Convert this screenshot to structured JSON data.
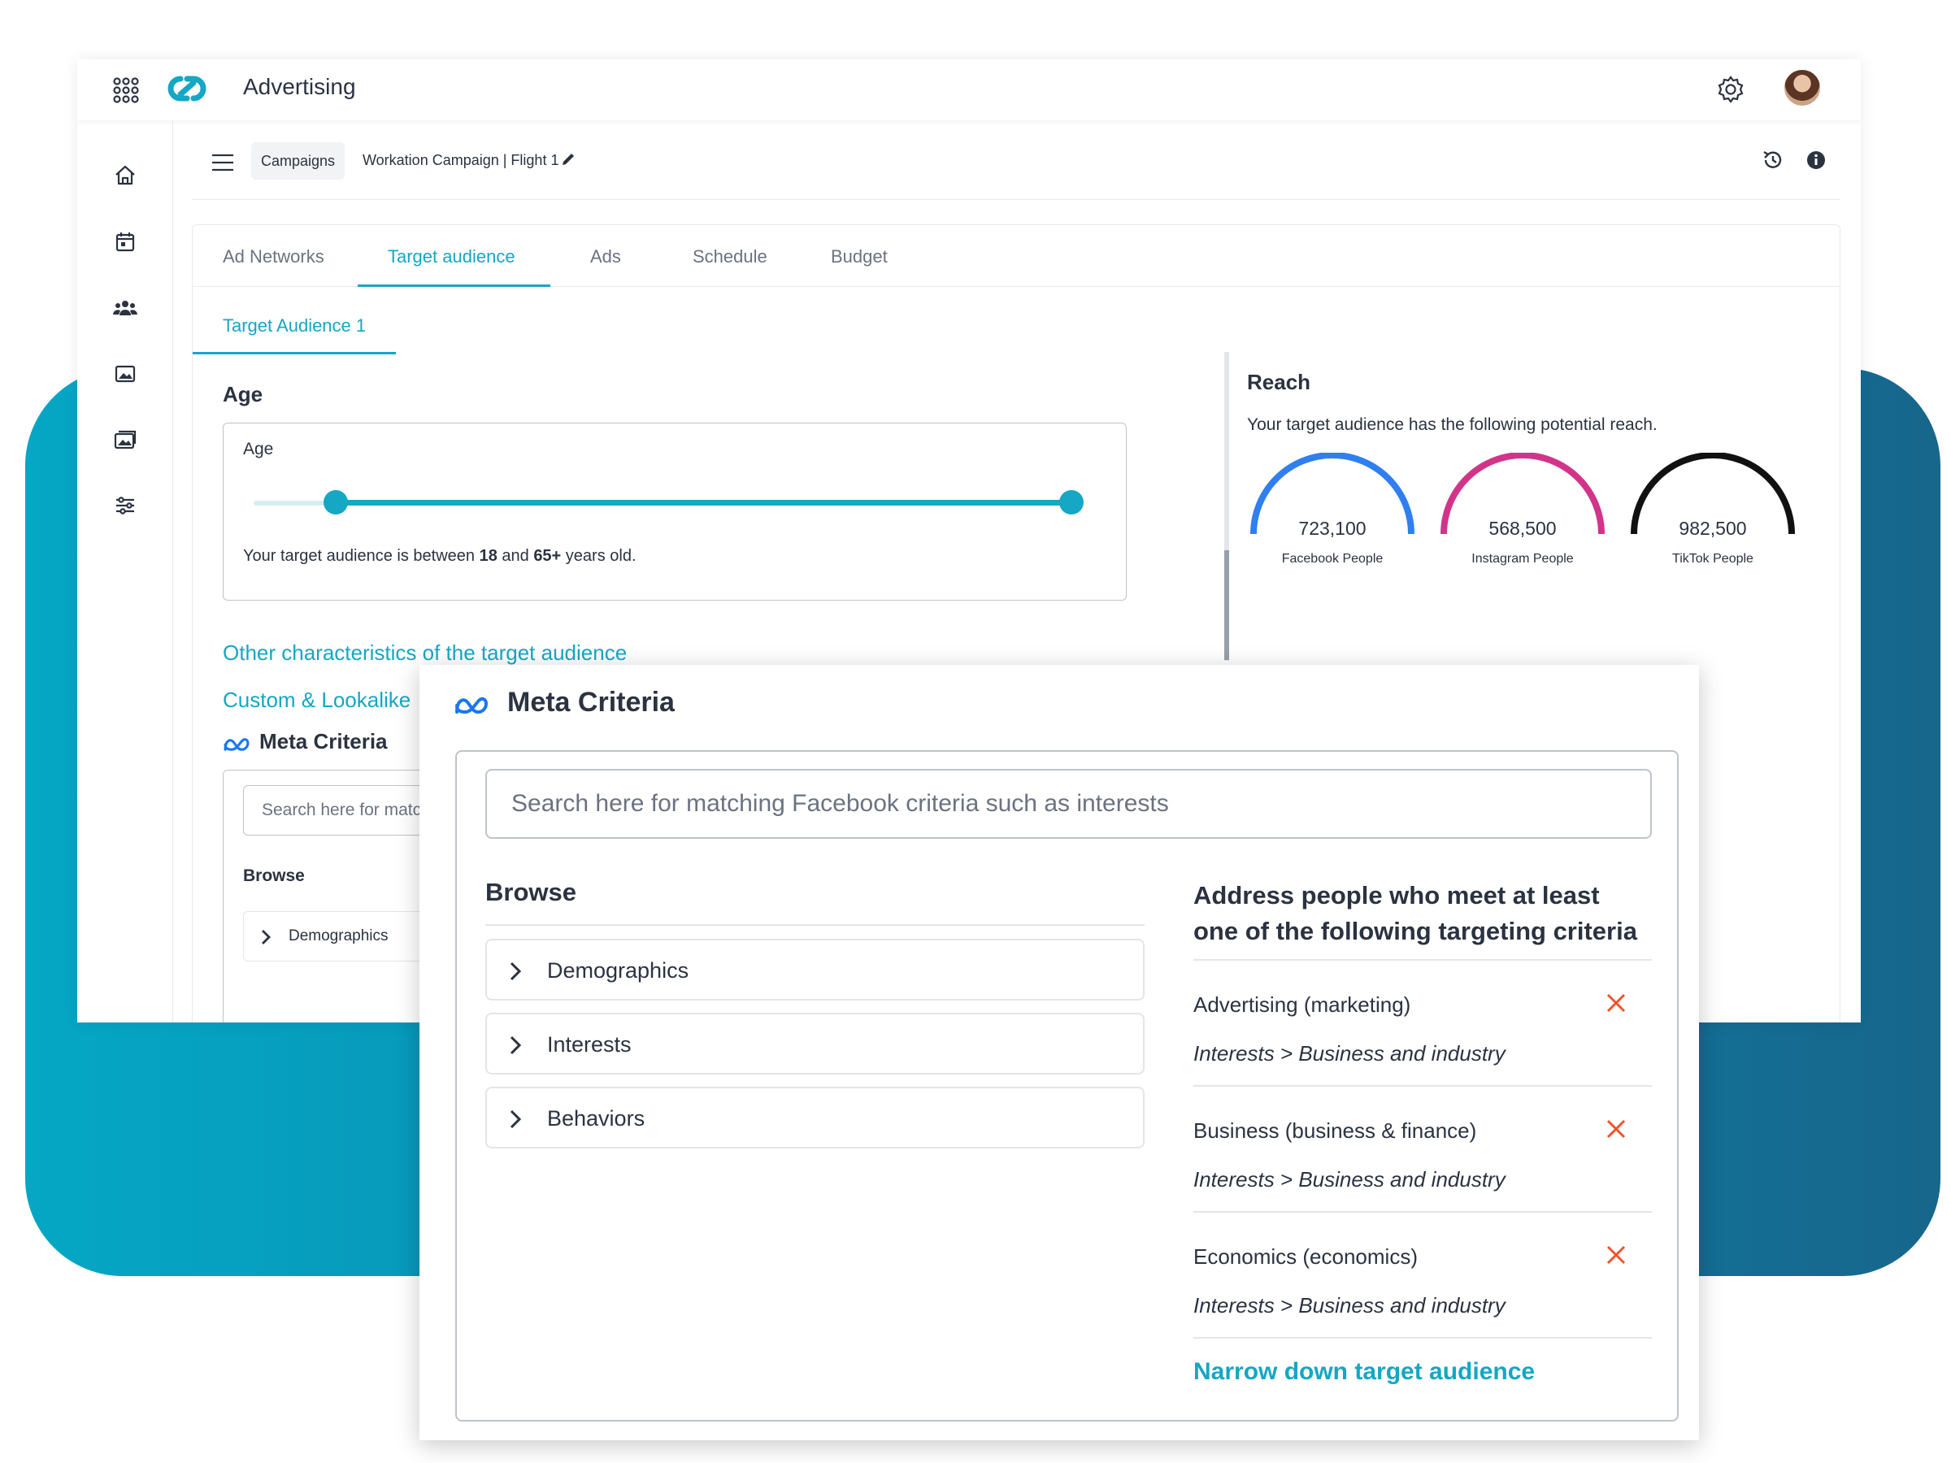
{
  "app": {
    "title": "Advertising"
  },
  "breadcrumb": {
    "campaigns": "Campaigns",
    "current": "Workation Campaign | Flight 1"
  },
  "tabs": [
    "Ad Networks",
    "Target audience",
    "Ads",
    "Schedule",
    "Budget"
  ],
  "active_tab": "Target audience",
  "subtab": "Target Audience 1",
  "age": {
    "section_title": "Age",
    "box_label": "Age",
    "min_value": 18,
    "max_value": "65+",
    "desc_prefix": "Your target audience is between ",
    "min": "18",
    "desc_mid": " and ",
    "max": "65+",
    "desc_suffix": " years old."
  },
  "links": {
    "other": "Other characteristics of the target audience",
    "custom": "Custom & Lookalike"
  },
  "meta_small": {
    "title": "Meta Criteria",
    "search_placeholder": "Search here for matching Facebook criteria such as interests",
    "browse": "Browse",
    "first_row": "Demographics"
  },
  "reach": {
    "title": "Reach",
    "desc": "Your target audience has the following potential reach.",
    "gauges": [
      {
        "value": "723,100",
        "label": "Facebook People",
        "color": "#2f7ff0"
      },
      {
        "value": "568,500",
        "label": "Instagram People",
        "color": "#d1358a"
      },
      {
        "value": "982,500",
        "label": "TikTok People",
        "color": "#111111"
      }
    ]
  },
  "overlay": {
    "title": "Meta Criteria",
    "search_placeholder": "Search here for matching Facebook criteria such as interests",
    "browse": "Browse",
    "browse_items": [
      "Demographics",
      "Interests",
      "Behaviors"
    ],
    "right_title": "Address people who meet at least one of the following targeting criteria",
    "criteria": [
      {
        "name": "Advertising (marketing)",
        "path": "Interests > Business and industry"
      },
      {
        "name": "Business (business & finance)",
        "path": "Interests > Business and industry"
      },
      {
        "name": "Economics (economics)",
        "path": "Interests > Business and industry"
      }
    ],
    "narrow_link": "Narrow down target audience"
  },
  "colors": {
    "accent": "#15a7c3",
    "remove": "#f0542d",
    "text": "#2b3240"
  }
}
